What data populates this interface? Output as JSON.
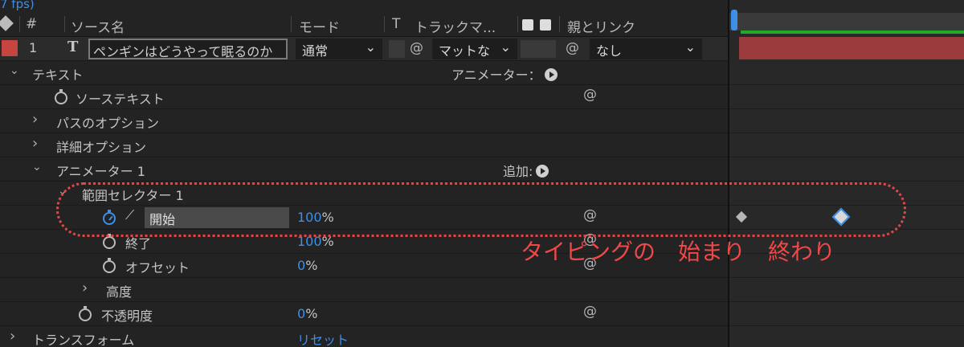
{
  "header": {
    "fps_fragment": "7 fps)",
    "hash": "#",
    "source_name": "ソース名",
    "mode": "モード",
    "t": "T",
    "track_matte": "トラックマ...",
    "parent_link": "親とリンク"
  },
  "layer": {
    "index": "1",
    "type_glyph": "T",
    "name": "ペンギンはどうやって眠るのか",
    "mode_value": "通常",
    "matte_value": "マットな",
    "parent_value": "なし",
    "color": "#c8443f"
  },
  "props": {
    "text_group": "テキスト",
    "animator_label": "アニメーター：",
    "source_text": "ソーステキスト",
    "path_options": "パスのオプション",
    "more_options": "詳細オプション",
    "animator1": "アニメーター 1",
    "add_label": "追加:",
    "range_selector": "範囲セレクター 1",
    "start": {
      "label": "開始",
      "value": "100",
      "unit": "%"
    },
    "end": {
      "label": "終了",
      "value": "100",
      "unit": "%"
    },
    "offset": {
      "label": "オフセット",
      "value": "0",
      "unit": "%"
    },
    "advanced": "高度",
    "opacity": {
      "label": "不透明度",
      "value": "0",
      "unit": "%"
    },
    "transform": "トランスフォーム",
    "reset": "リセット"
  },
  "annotation": {
    "text": "タイピングの　始まり　終わり",
    "color": "#f04848"
  },
  "icons": {
    "spiral": "@",
    "chevron_right": "›",
    "chevron_down": "⌄",
    "dropdown": "⌵"
  }
}
